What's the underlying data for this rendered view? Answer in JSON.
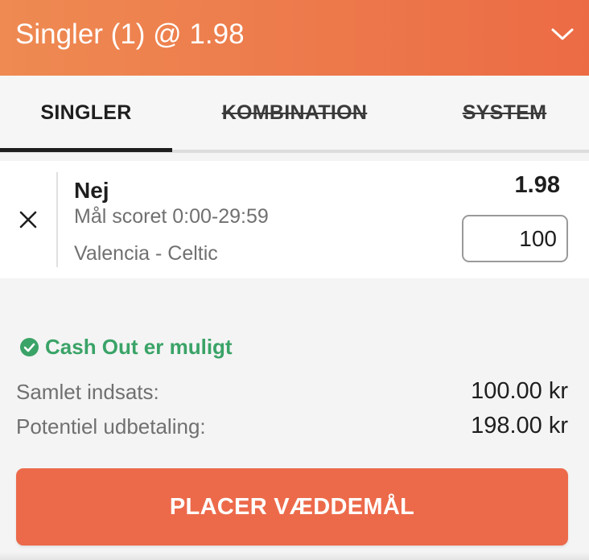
{
  "header": {
    "title": "Singler (1) @ 1.98",
    "collapse_icon": "chevron-down-icon",
    "gradient_start": "#ee8a52",
    "gradient_end": "#ec6b45"
  },
  "tabs": [
    {
      "label": "SINGLER",
      "state": "active"
    },
    {
      "label": "KOMBINATION",
      "state": "disabled"
    },
    {
      "label": "SYSTEM",
      "state": "disabled"
    }
  ],
  "bet": {
    "remove_icon": "close-icon",
    "selection": "Nej",
    "market": "Mål scoret 0:00-29:59",
    "event": "Valencia - Celtic",
    "odds": "1.98",
    "stake_value": "100"
  },
  "cashout": {
    "icon": "check-circle-icon",
    "label": "Cash Out er muligt",
    "color": "#3aa367"
  },
  "summary": {
    "total_stake_label": "Samlet indsats:",
    "total_stake_value": "100.00 kr",
    "potential_payout_label": "Potentiel udbetaling:",
    "potential_payout_value": "198.00 kr"
  },
  "actions": {
    "place_bet_label": "PLACER VÆDDEMÅL",
    "accent_color": "#ec6a4a"
  }
}
